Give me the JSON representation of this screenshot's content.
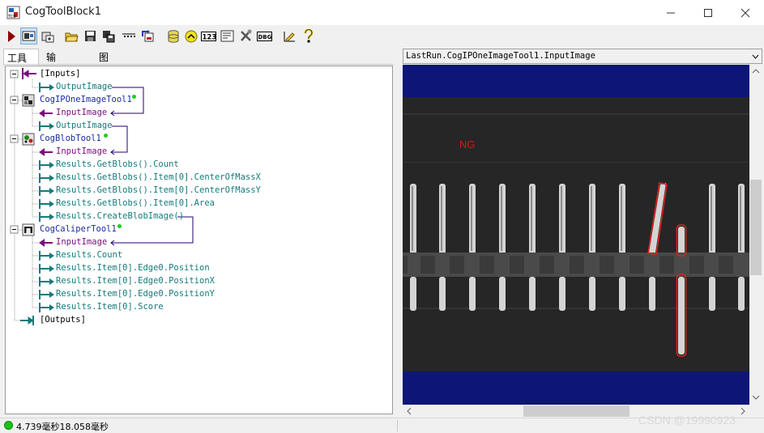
{
  "window": {
    "title": "CogToolBlock1",
    "minimize_glyph": "—",
    "maximize_glyph": "☐",
    "close_glyph": "✕"
  },
  "tabs": [
    {
      "label": "工具",
      "selected": true
    },
    {
      "label": "输入/输出",
      "selected": false
    },
    {
      "label": "图形",
      "selected": false
    }
  ],
  "toolbar": {
    "items": [
      "run-icon",
      "show-image-icon",
      "add-tool-icon",
      "open-icon",
      "save-icon",
      "save-copy-icon",
      "terminal-icon",
      "reset-icon",
      "database-icon",
      "links-icon",
      "numeric-icon",
      "settings-icon",
      "tools-icon",
      "debug-icon",
      "measure-icon",
      "help-icon"
    ],
    "numeric_label": "123",
    "debug_label": "DBG"
  },
  "tree": {
    "inputs": "[Inputs]",
    "input_output_image": "OutputImage",
    "tool1": {
      "name": "CogIPOneImageTool1",
      "input": "InputImage",
      "output": "OutputImage"
    },
    "tool2": {
      "name": "CogBlobTool1",
      "input": "InputImage",
      "outputs": [
        "Results.GetBlobs().Count",
        "Results.GetBlobs().Item[0].CenterOfMassX",
        "Results.GetBlobs().Item[0].CenterOfMassY",
        "Results.GetBlobs().Item[0].Area",
        "Results.CreateBlobImage()"
      ]
    },
    "tool3": {
      "name": "CogCaliperTool1",
      "input": "InputImage",
      "outputs": [
        "Results.Count",
        "Results.Item[0].Edge0.Position",
        "Results.Item[0].Edge0.PositionX",
        "Results.Item[0].Edge0.PositionY",
        "Results.Item[0].Score"
      ]
    },
    "outputs": "[Outputs]"
  },
  "image_view": {
    "title": "LastRun.CogIPOneImageTool1.InputImage",
    "verdict": "NG",
    "verdict_color": "#d81818",
    "background": "#0d1677",
    "defect_outline_color": "#e02020"
  },
  "status": {
    "text": "4.739毫秒18.058毫秒"
  },
  "watermark": "CSDN @19990923"
}
